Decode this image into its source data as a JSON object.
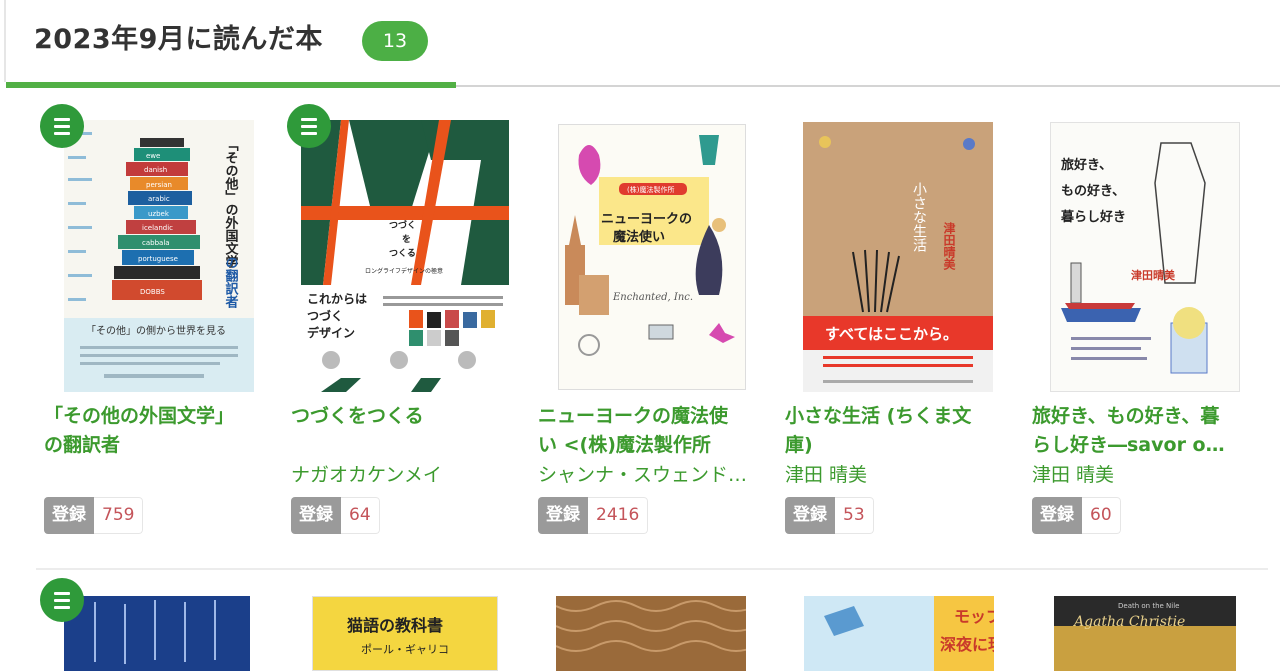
{
  "header": {
    "title": "2023年9月に読んだ本",
    "count": "13"
  },
  "icons": {
    "menu": "hamburger-menu-icon"
  },
  "colors": {
    "accent": "#52b045",
    "badge": "#4caf45",
    "link": "#3c9a2e",
    "count_text": "#c4545a",
    "reg_label_bg": "#9a9a9a"
  },
  "register_label": "登録",
  "books": [
    {
      "title": "「その他の外国文学」の翻訳者",
      "author": "",
      "count": "759",
      "cover_text": [
        "「その他」の外国文学",
        "の翻訳者",
        "「その他」の側から世界を見る"
      ],
      "spines": [
        "ewe",
        "danish",
        "persian",
        "arabic",
        "uzbek",
        "icelandic",
        "cabbala",
        "portuguese",
        "DOBBS"
      ]
    },
    {
      "title": "つづくをつくる",
      "author": "ナガオカケンメイ",
      "count": "64",
      "cover_text": [
        "つづく",
        "を",
        "つくる",
        "ロングライフデザインの極意",
        "これからはつづくデザイン"
      ]
    },
    {
      "title": "ニューヨークの魔法使い <(株)魔法製作所",
      "author": "シャンナ・スウェンドソン",
      "count": "2416",
      "cover_text": [
        "(株)魔法製作所",
        "ニューヨークの",
        "魔法使い",
        "Enchanted, Inc."
      ]
    },
    {
      "title": "小さな生活 (ちくま文庫)",
      "author": "津田 晴美",
      "count": "53",
      "cover_text": [
        "小さな生活",
        "津田晴美",
        "すべてはここから。"
      ]
    },
    {
      "title": "旅好き、もの好き、暮らし好き―savor o…",
      "author": "津田 晴美",
      "count": "60",
      "cover_text": [
        "旅好き、",
        "もの好き、",
        "暮らし好き",
        "津田晴美"
      ]
    }
  ],
  "next_row": [
    {
      "cover_text": ""
    },
    {
      "cover_text": "猫語の教科書"
    },
    {
      "cover_text": "ポール・ギャリコ"
    },
    {
      "cover_text": "モップの"
    },
    {
      "cover_text": "深夜に現"
    },
    {
      "cover_text": "Agatha Christie"
    },
    {
      "cover_text": "Death on the Nile"
    }
  ]
}
